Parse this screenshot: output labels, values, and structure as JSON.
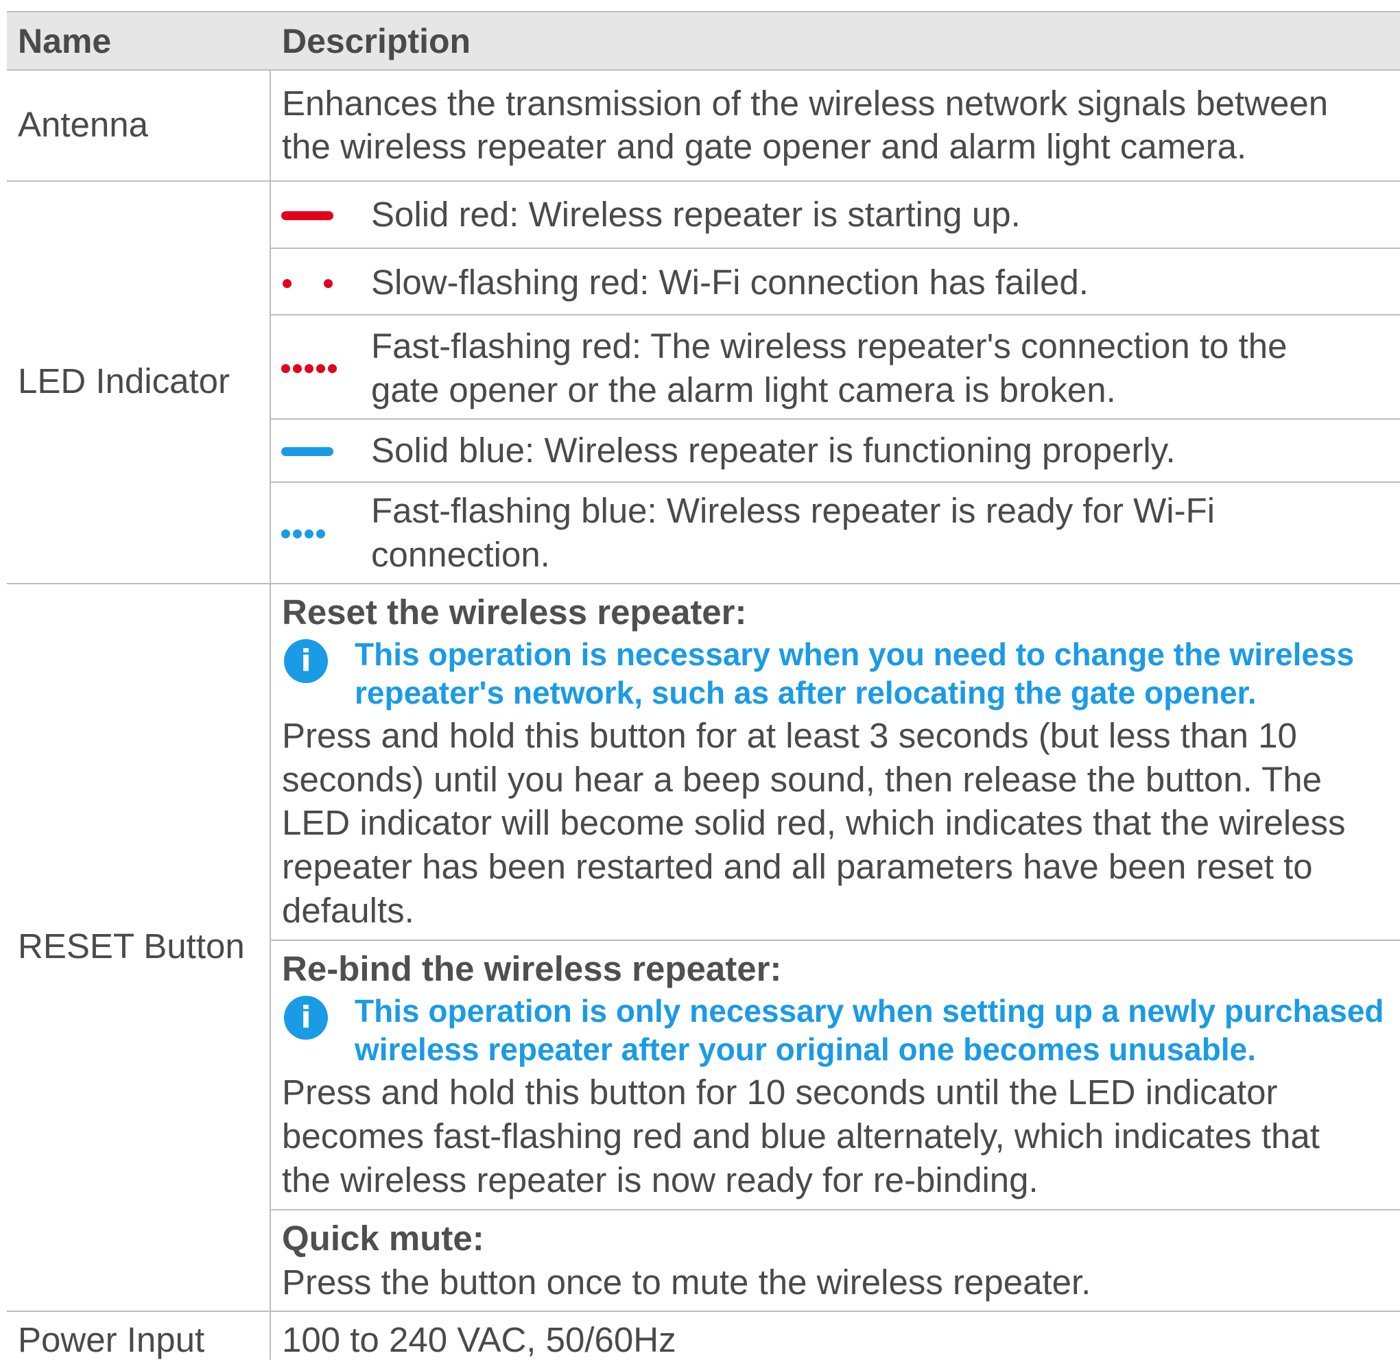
{
  "table": {
    "header": {
      "name": "Name",
      "description": "Description"
    },
    "antenna": {
      "name": "Antenna",
      "desc_line1": "Enhances the transmission of the wireless network signals between",
      "desc_line2": "the wireless repeater and gate opener and alarm light camera."
    },
    "led": {
      "name": "LED Indicator",
      "solid_red": "Solid red: Wireless repeater is starting up.",
      "slow_red": "Slow-flashing red: Wi-Fi connection has failed.",
      "fast_red_line1": "Fast-flashing red: The wireless repeater's connection to the",
      "fast_red_line2": "gate opener or the alarm light camera is broken.",
      "solid_blue": "Solid blue: Wireless repeater is functioning properly.",
      "fast_blue_line1": "Fast-flashing blue: Wireless repeater is ready for Wi-Fi",
      "fast_blue_line2": "connection.",
      "colors": {
        "red": "#e3001b",
        "blue": "#1a9be6"
      },
      "icons": [
        "led-solid-red-icon",
        "led-slow-flash-red-icon",
        "led-fast-flash-red-icon",
        "led-solid-blue-icon",
        "led-fast-flash-blue-icon"
      ]
    },
    "reset": {
      "name": "RESET Button",
      "reset_title": "Reset the wireless repeater:",
      "reset_note_line1": "This operation is necessary when you need to change the wireless",
      "reset_note_line2": "repeater's network, such as after relocating the gate opener.",
      "reset_line1": "Press and hold this button for at least 3 seconds (but less than 10",
      "reset_line2": "seconds) until you hear a beep sound, then release the button. The",
      "reset_line3": "LED indicator will become solid red, which indicates that the wireless",
      "reset_line4": "repeater has been restarted and all parameters have been reset to",
      "reset_line5": "defaults.",
      "rebind_title": "Re-bind the wireless repeater:",
      "rebind_note_line1": "This operation is only necessary when setting up a newly purchased",
      "rebind_note_line2": "wireless repeater after your original one becomes unusable.",
      "rebind_line1": "Press and hold this button for 10 seconds until the LED indicator",
      "rebind_line2": "becomes fast-flashing red and blue alternately, which indicates that",
      "rebind_line3": "the wireless repeater is now ready for re-binding.",
      "mute_title": "Quick mute:",
      "mute_line1": "Press the button once to mute the wireless repeater.",
      "info_icon_glyph": "i"
    },
    "power": {
      "name": "Power Input",
      "desc": "100 to 240 VAC, 50/60Hz"
    }
  }
}
